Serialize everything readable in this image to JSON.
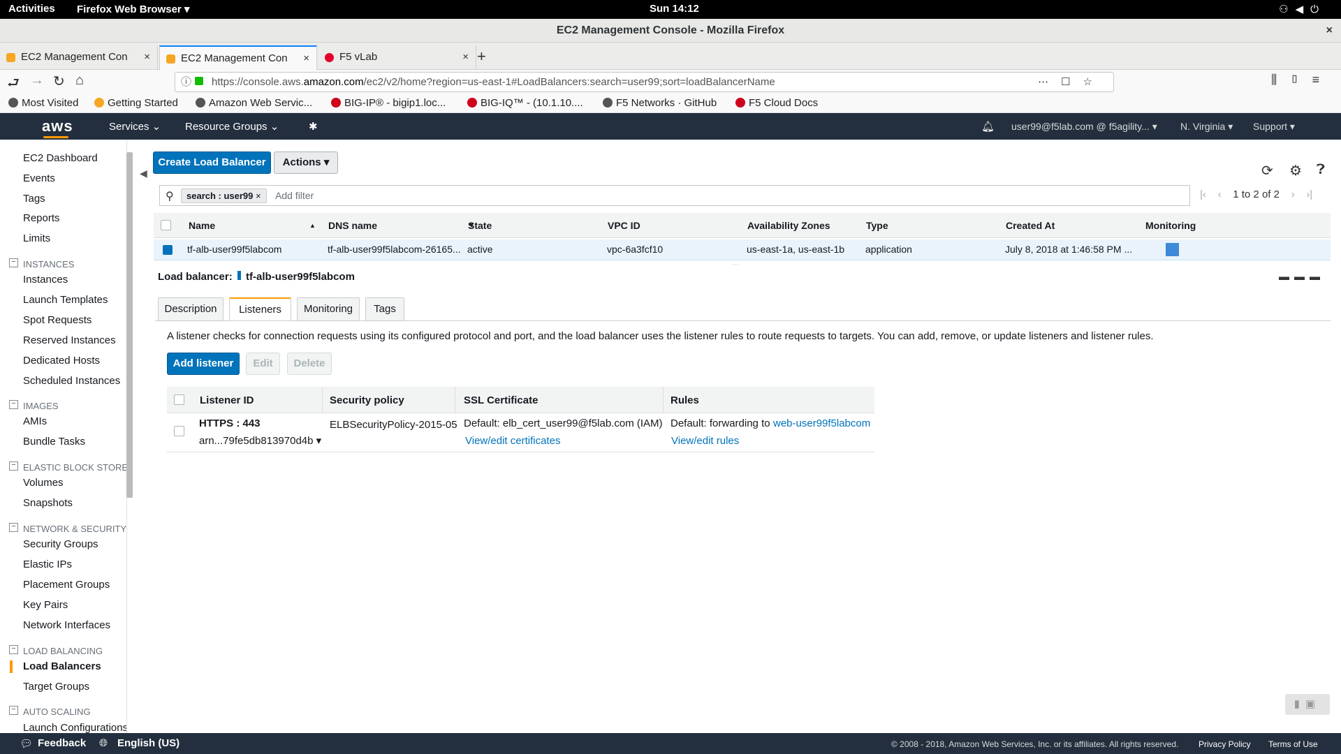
{
  "gnome": {
    "activities": "Activities",
    "app": "Firefox Web Browser ▾",
    "clock": "Sun 14:12"
  },
  "window": {
    "title": "EC2 Management Console - Mozilla Firefox",
    "close": "×"
  },
  "tabs": [
    {
      "label": "EC2 Management Con",
      "close": "×"
    },
    {
      "label": "EC2 Management Con",
      "close": "×"
    },
    {
      "label": "F5 vLab",
      "close": "×"
    }
  ],
  "newtab": "+",
  "url": {
    "pre": "https://console.aws.",
    "domain": "amazon.com",
    "post": "/ec2/v2/home?region=us-east-1#LoadBalancers:search=user99;sort=loadBalancerName"
  },
  "bookmarks": [
    "Most Visited",
    "Getting Started",
    "Amazon Web Servic...",
    "BIG-IP® - bigip1.loc...",
    "BIG-IQ™ - (10.1.10....",
    "F5 Networks · GitHub",
    "F5 Cloud Docs"
  ],
  "aws": {
    "logo": "aws",
    "services": "Services ⌄",
    "resource_groups": "Resource Groups ⌄",
    "user": "user99@f5lab.com @ f5agility... ▾",
    "region": "N. Virginia ▾",
    "support": "Support ▾"
  },
  "sidebar": {
    "items": [
      "EC2 Dashboard",
      "Events",
      "Tags",
      "Reports",
      "Limits"
    ],
    "sections": [
      {
        "title": "INSTANCES",
        "items": [
          "Instances",
          "Launch Templates",
          "Spot Requests",
          "Reserved Instances",
          "Dedicated Hosts",
          "Scheduled Instances"
        ]
      },
      {
        "title": "IMAGES",
        "items": [
          "AMIs",
          "Bundle Tasks"
        ]
      },
      {
        "title": "ELASTIC BLOCK STORE",
        "items": [
          "Volumes",
          "Snapshots"
        ]
      },
      {
        "title": "NETWORK & SECURITY",
        "items": [
          "Security Groups",
          "Elastic IPs",
          "Placement Groups",
          "Key Pairs",
          "Network Interfaces"
        ]
      },
      {
        "title": "LOAD BALANCING",
        "items": [
          "Load Balancers",
          "Target Groups"
        ]
      },
      {
        "title": "AUTO SCALING",
        "items": [
          "Launch Configurations"
        ]
      }
    ]
  },
  "toolbar": {
    "create": "Create Load Balancer",
    "actions": "Actions ▾"
  },
  "filter": {
    "tag": "search : user99",
    "tag_remove": "×",
    "placeholder": "Add filter"
  },
  "pager": {
    "text": "1 to 2 of 2"
  },
  "table": {
    "headers": [
      "Name",
      "DNS name",
      "State",
      "VPC ID",
      "Availability Zones",
      "Type",
      "Created At",
      "Monitoring"
    ],
    "row": [
      "tf-alb-user99f5labcom",
      "tf-alb-user99f5labcom-26165...",
      "active",
      "vpc-6a3fcf10",
      "us-east-1a, us-east-1b",
      "application",
      "July 8, 2018 at 1:46:58 PM ..."
    ]
  },
  "detail": {
    "title_prefix": "Load balancer:",
    "title_name": "tf-alb-user99f5labcom",
    "tabs": [
      "Description",
      "Listeners",
      "Monitoring",
      "Tags"
    ],
    "description": "A listener checks for connection requests using its configured protocol and port, and the load balancer uses the listener rules to route requests to targets. You can add, remove, or update listeners and listener rules.",
    "buttons": {
      "add": "Add listener",
      "edit": "Edit",
      "delete": "Delete"
    }
  },
  "listeners": {
    "headers": [
      "Listener ID",
      "Security policy",
      "SSL Certificate",
      "Rules"
    ],
    "row": {
      "id": "HTTPS : 443",
      "arn": "arn...79fe5db813970d4b ▾",
      "policy": "ELBSecurityPolicy-2015-05",
      "cert": "Default:  elb_cert_user99@f5lab.com (IAM)",
      "cert_link": "View/edit certificates",
      "rules_prefix": "Default:  forwarding to",
      "rules_target": "web-user99f5labcom",
      "rules_link": "View/edit rules"
    }
  },
  "footer": {
    "feedback": "Feedback",
    "language": "English (US)",
    "copyright": "© 2008 - 2018, Amazon Web Services, Inc. or its affiliates. All rights reserved.",
    "privacy": "Privacy Policy",
    "terms": "Terms of Use"
  }
}
